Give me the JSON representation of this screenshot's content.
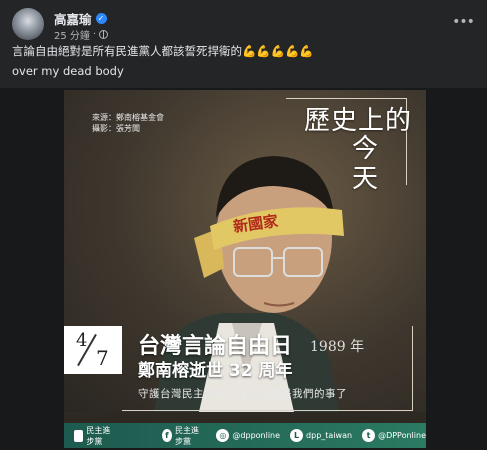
{
  "post": {
    "author": "高嘉瑜",
    "time": "25 分鐘",
    "separator": "·",
    "text_line1": "言論自由絕對是所有民進黨人都該誓死捍衛的💪💪💪💪💪",
    "text_line2": "over my dead body"
  },
  "poster": {
    "source_line1": "來源：鄭南榕基金會",
    "source_line2": "攝影：張芳聞",
    "history_line1": "歷史上的",
    "history_line2": "今",
    "history_line3": "天",
    "headband": "新國家",
    "date_month": "4",
    "date_day": "7",
    "title1": "台灣言論自由日",
    "year": "1989 年",
    "title2": "鄭南榕逝世 32 周年",
    "slogan": "守護台灣民主未來　接下來就是我們的事了",
    "footer": {
      "party": "民主進步黨",
      "facebook": "民主進步黨",
      "instagram": "@dpponline",
      "line": "dpp_taiwan",
      "twitter": "@DPPonline"
    }
  },
  "icons": {
    "verified": "verified-badge-icon",
    "privacy": "globe-icon",
    "more": "more-horizontal-icon"
  },
  "colors": {
    "background": "#242526",
    "accent": "#2d88ff",
    "footer_green": "#1d5a4f"
  }
}
